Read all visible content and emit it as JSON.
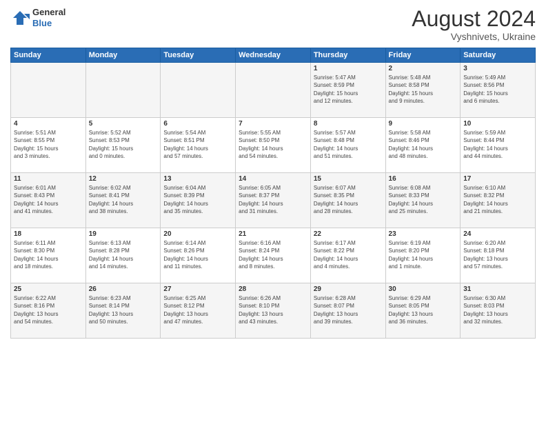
{
  "header": {
    "logo_general": "General",
    "logo_blue": "Blue",
    "month_title": "August 2024",
    "location": "Vyshnivets, Ukraine"
  },
  "days_of_week": [
    "Sunday",
    "Monday",
    "Tuesday",
    "Wednesday",
    "Thursday",
    "Friday",
    "Saturday"
  ],
  "weeks": [
    [
      {
        "day": "",
        "info": ""
      },
      {
        "day": "",
        "info": ""
      },
      {
        "day": "",
        "info": ""
      },
      {
        "day": "",
        "info": ""
      },
      {
        "day": "1",
        "info": "Sunrise: 5:47 AM\nSunset: 8:59 PM\nDaylight: 15 hours\nand 12 minutes."
      },
      {
        "day": "2",
        "info": "Sunrise: 5:48 AM\nSunset: 8:58 PM\nDaylight: 15 hours\nand 9 minutes."
      },
      {
        "day": "3",
        "info": "Sunrise: 5:49 AM\nSunset: 8:56 PM\nDaylight: 15 hours\nand 6 minutes."
      }
    ],
    [
      {
        "day": "4",
        "info": "Sunrise: 5:51 AM\nSunset: 8:55 PM\nDaylight: 15 hours\nand 3 minutes."
      },
      {
        "day": "5",
        "info": "Sunrise: 5:52 AM\nSunset: 8:53 PM\nDaylight: 15 hours\nand 0 minutes."
      },
      {
        "day": "6",
        "info": "Sunrise: 5:54 AM\nSunset: 8:51 PM\nDaylight: 14 hours\nand 57 minutes."
      },
      {
        "day": "7",
        "info": "Sunrise: 5:55 AM\nSunset: 8:50 PM\nDaylight: 14 hours\nand 54 minutes."
      },
      {
        "day": "8",
        "info": "Sunrise: 5:57 AM\nSunset: 8:48 PM\nDaylight: 14 hours\nand 51 minutes."
      },
      {
        "day": "9",
        "info": "Sunrise: 5:58 AM\nSunset: 8:46 PM\nDaylight: 14 hours\nand 48 minutes."
      },
      {
        "day": "10",
        "info": "Sunrise: 5:59 AM\nSunset: 8:44 PM\nDaylight: 14 hours\nand 44 minutes."
      }
    ],
    [
      {
        "day": "11",
        "info": "Sunrise: 6:01 AM\nSunset: 8:43 PM\nDaylight: 14 hours\nand 41 minutes."
      },
      {
        "day": "12",
        "info": "Sunrise: 6:02 AM\nSunset: 8:41 PM\nDaylight: 14 hours\nand 38 minutes."
      },
      {
        "day": "13",
        "info": "Sunrise: 6:04 AM\nSunset: 8:39 PM\nDaylight: 14 hours\nand 35 minutes."
      },
      {
        "day": "14",
        "info": "Sunrise: 6:05 AM\nSunset: 8:37 PM\nDaylight: 14 hours\nand 31 minutes."
      },
      {
        "day": "15",
        "info": "Sunrise: 6:07 AM\nSunset: 8:35 PM\nDaylight: 14 hours\nand 28 minutes."
      },
      {
        "day": "16",
        "info": "Sunrise: 6:08 AM\nSunset: 8:33 PM\nDaylight: 14 hours\nand 25 minutes."
      },
      {
        "day": "17",
        "info": "Sunrise: 6:10 AM\nSunset: 8:32 PM\nDaylight: 14 hours\nand 21 minutes."
      }
    ],
    [
      {
        "day": "18",
        "info": "Sunrise: 6:11 AM\nSunset: 8:30 PM\nDaylight: 14 hours\nand 18 minutes."
      },
      {
        "day": "19",
        "info": "Sunrise: 6:13 AM\nSunset: 8:28 PM\nDaylight: 14 hours\nand 14 minutes."
      },
      {
        "day": "20",
        "info": "Sunrise: 6:14 AM\nSunset: 8:26 PM\nDaylight: 14 hours\nand 11 minutes."
      },
      {
        "day": "21",
        "info": "Sunrise: 6:16 AM\nSunset: 8:24 PM\nDaylight: 14 hours\nand 8 minutes."
      },
      {
        "day": "22",
        "info": "Sunrise: 6:17 AM\nSunset: 8:22 PM\nDaylight: 14 hours\nand 4 minutes."
      },
      {
        "day": "23",
        "info": "Sunrise: 6:19 AM\nSunset: 8:20 PM\nDaylight: 14 hours\nand 1 minute."
      },
      {
        "day": "24",
        "info": "Sunrise: 6:20 AM\nSunset: 8:18 PM\nDaylight: 13 hours\nand 57 minutes."
      }
    ],
    [
      {
        "day": "25",
        "info": "Sunrise: 6:22 AM\nSunset: 8:16 PM\nDaylight: 13 hours\nand 54 minutes."
      },
      {
        "day": "26",
        "info": "Sunrise: 6:23 AM\nSunset: 8:14 PM\nDaylight: 13 hours\nand 50 minutes."
      },
      {
        "day": "27",
        "info": "Sunrise: 6:25 AM\nSunset: 8:12 PM\nDaylight: 13 hours\nand 47 minutes."
      },
      {
        "day": "28",
        "info": "Sunrise: 6:26 AM\nSunset: 8:10 PM\nDaylight: 13 hours\nand 43 minutes."
      },
      {
        "day": "29",
        "info": "Sunrise: 6:28 AM\nSunset: 8:07 PM\nDaylight: 13 hours\nand 39 minutes."
      },
      {
        "day": "30",
        "info": "Sunrise: 6:29 AM\nSunset: 8:05 PM\nDaylight: 13 hours\nand 36 minutes."
      },
      {
        "day": "31",
        "info": "Sunrise: 6:30 AM\nSunset: 8:03 PM\nDaylight: 13 hours\nand 32 minutes."
      }
    ]
  ]
}
